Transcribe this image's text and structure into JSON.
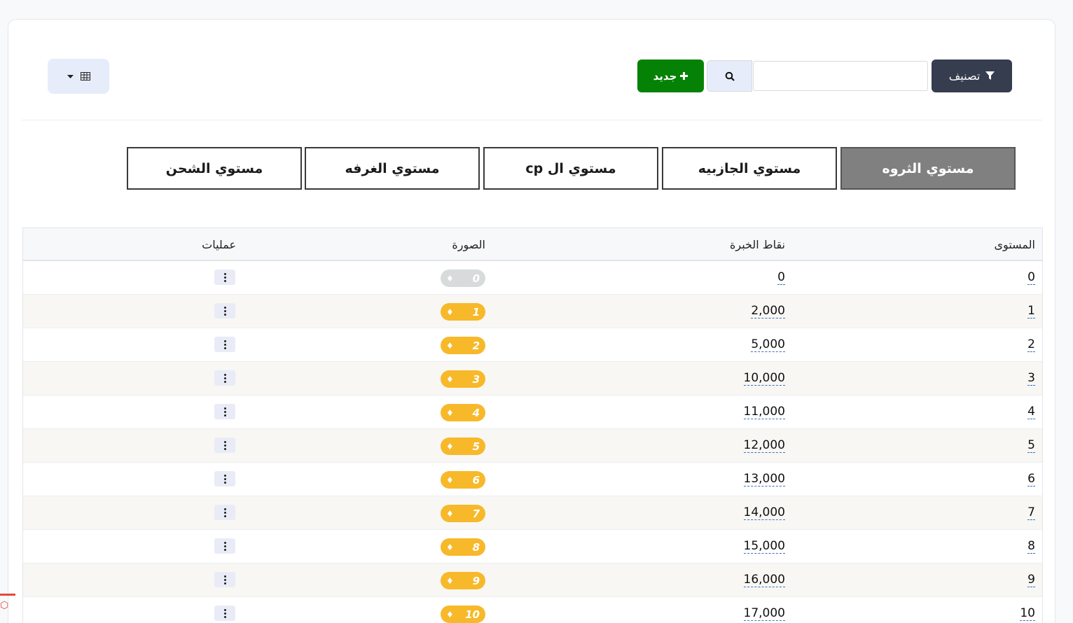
{
  "toolbar": {
    "filter_label": "تصنيف",
    "search_placeholder": "",
    "new_label": "جديد"
  },
  "tabs": [
    {
      "label": "مستوي الثروه",
      "active": true
    },
    {
      "label": "مستوي الجازبيه",
      "active": false
    },
    {
      "label": "مستوي ال cp",
      "active": false
    },
    {
      "label": "مستوي الغرفه",
      "active": false
    },
    {
      "label": "مستوي الشحن",
      "active": false
    }
  ],
  "table": {
    "headers": {
      "level": "المستوى",
      "xp": "نقاط الخبرة",
      "image": "الصورة",
      "actions": "عمليات"
    },
    "rows": [
      {
        "level": "0",
        "xp": "0",
        "badge": "0"
      },
      {
        "level": "1",
        "xp": "2,000",
        "badge": "1"
      },
      {
        "level": "2",
        "xp": "5,000",
        "badge": "2"
      },
      {
        "level": "3",
        "xp": "10,000",
        "badge": "3"
      },
      {
        "level": "4",
        "xp": "11,000",
        "badge": "4"
      },
      {
        "level": "5",
        "xp": "12,000",
        "badge": "5"
      },
      {
        "level": "6",
        "xp": "13,000",
        "badge": "6"
      },
      {
        "level": "7",
        "xp": "14,000",
        "badge": "7"
      },
      {
        "level": "8",
        "xp": "15,000",
        "badge": "8"
      },
      {
        "level": "9",
        "xp": "16,000",
        "badge": "9"
      },
      {
        "level": "10",
        "xp": "17,000",
        "badge": "10"
      }
    ]
  },
  "colors": {
    "filter_button": "#363d4f",
    "new_button": "#058205",
    "active_tab": "#808080",
    "badge_gold": "#f7b92a",
    "badge_grey": "#d7dbdb"
  },
  "icons": {
    "filter": "funnel-icon",
    "search": "search-icon",
    "new": "plus-icon",
    "view": "table-grid-icon",
    "actions": "vertical-dots-icon",
    "badge": "diamond-icon"
  }
}
